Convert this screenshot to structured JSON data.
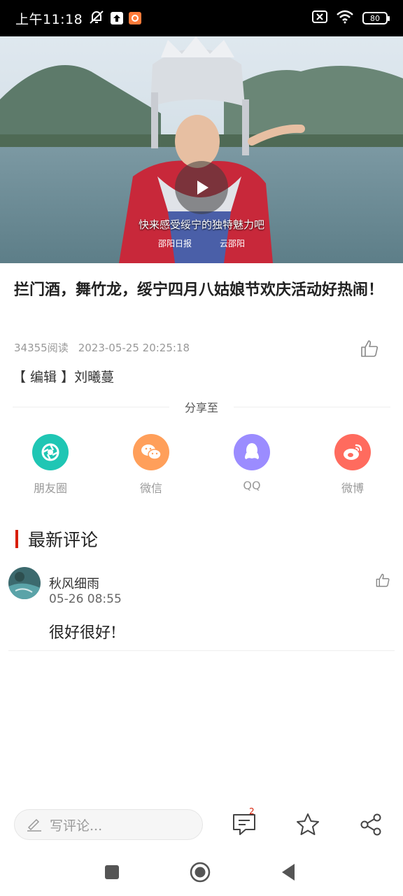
{
  "status_bar": {
    "time": "上午11:18",
    "battery": "80",
    "icons": [
      "mute-bell-icon",
      "upload-icon",
      "app-notification-icon",
      "sim-off-icon",
      "wifi-icon",
      "battery-icon"
    ]
  },
  "video": {
    "subtitle": "快来感受绥宁的独特魅力吧",
    "logo_left": "邵阳日报",
    "logo_right": "云邵阳",
    "play_icon": "play-icon"
  },
  "article": {
    "title": "拦门酒，舞竹龙，绥宁四月八姑娘节欢庆活动好热闹！",
    "reads": "34355阅读",
    "datetime": "2023-05-25 20:25:18",
    "editor": "【 编辑 】刘曦蔓"
  },
  "share": {
    "heading": "分享至",
    "items": [
      {
        "label": "朋友圈",
        "icon": "moments-icon",
        "color": "#1fc6b4"
      },
      {
        "label": "微信",
        "icon": "wechat-icon",
        "color": "#ff9f5a"
      },
      {
        "label": "QQ",
        "icon": "qq-icon",
        "color": "#9b8cff"
      },
      {
        "label": "微博",
        "icon": "weibo-icon",
        "color": "#ff6b5e"
      }
    ]
  },
  "comments": {
    "heading": "最新评论",
    "accent": "#d81e06",
    "items": [
      {
        "user": "秋风细雨",
        "time": "05-26 08:55",
        "text": "很好很好!"
      }
    ]
  },
  "toolbar": {
    "comment_placeholder": "写评论...",
    "comment_count": "2"
  }
}
